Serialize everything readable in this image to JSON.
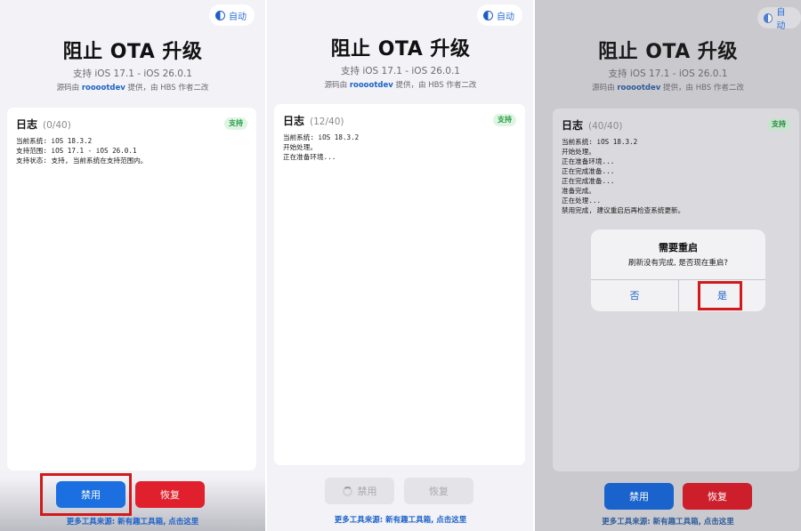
{
  "colors": {
    "accent_blue": "#1b6fe0",
    "danger_red": "#e0202c",
    "support_green": "#2a9d4a",
    "highlight_red": "#d11a1a"
  },
  "icons": {
    "appearance": "half-circle-icon",
    "loading": "spinner-icon"
  },
  "panels": [
    {
      "auto_label": "自动",
      "title": "阻止 OTA 升级",
      "subtitle": "支持 iOS 17.1 - iOS 26.0.1",
      "credit_prefix": "源码由",
      "credit_link": "roooot​dev",
      "credit_suffix": "提供，由 HBS 作者二改",
      "log_title": "日志",
      "log_count": "(0/40)",
      "badge": "支持",
      "log_lines": [
        "当前系统: iOS 18.3.2",
        "支持范围: iOS 17.1 - iOS 26.0.1",
        "支持状态: 支持, 当前系统在支持范围内。"
      ],
      "disable_label": "禁用",
      "restore_label": "恢复",
      "footer": "更多工具来源: 新有趣工具箱, 点击这里"
    },
    {
      "auto_label": "自动",
      "title": "阻止 OTA 升级",
      "subtitle": "支持 iOS 17.1 - iOS 26.0.1",
      "credit_prefix": "源码由",
      "credit_link": "rooootdev",
      "credit_suffix": "提供，由 HBS 作者二改",
      "log_title": "日志",
      "log_count": "(12/40)",
      "badge": "支持",
      "log_lines": [
        "当前系统: iOS 18.3.2",
        "开始处理。",
        "正在准备环境..."
      ],
      "disable_label": "禁用",
      "restore_label": "恢复",
      "footer": "更多工具来源: 新有趣工具箱, 点击这里"
    },
    {
      "auto_label": "自动",
      "title": "阻止 OTA 升级",
      "subtitle": "支持 iOS 17.1 - iOS 26.0.1",
      "credit_prefix": "源码由",
      "credit_link": "rooootdev",
      "credit_suffix": "提供，由 HBS 作者二改",
      "log_title": "日志",
      "log_count": "(40/40)",
      "badge": "支持",
      "log_lines": [
        "当前系统: iOS 18.3.2",
        "开始处理。",
        "正在准备环境...",
        "正在完成准备...",
        "正在完成准备...",
        "准备完成。",
        "正在处理...",
        "禁用完成, 建议重启后再检查系统更新。"
      ],
      "disable_label": "禁用",
      "restore_label": "恢复",
      "footer": "更多工具来源: 新有趣工具箱, 点击这里",
      "alert": {
        "title": "需要重启",
        "message": "刷新没有完成, 是否现在重启?",
        "no_label": "否",
        "yes_label": "是"
      }
    }
  ]
}
